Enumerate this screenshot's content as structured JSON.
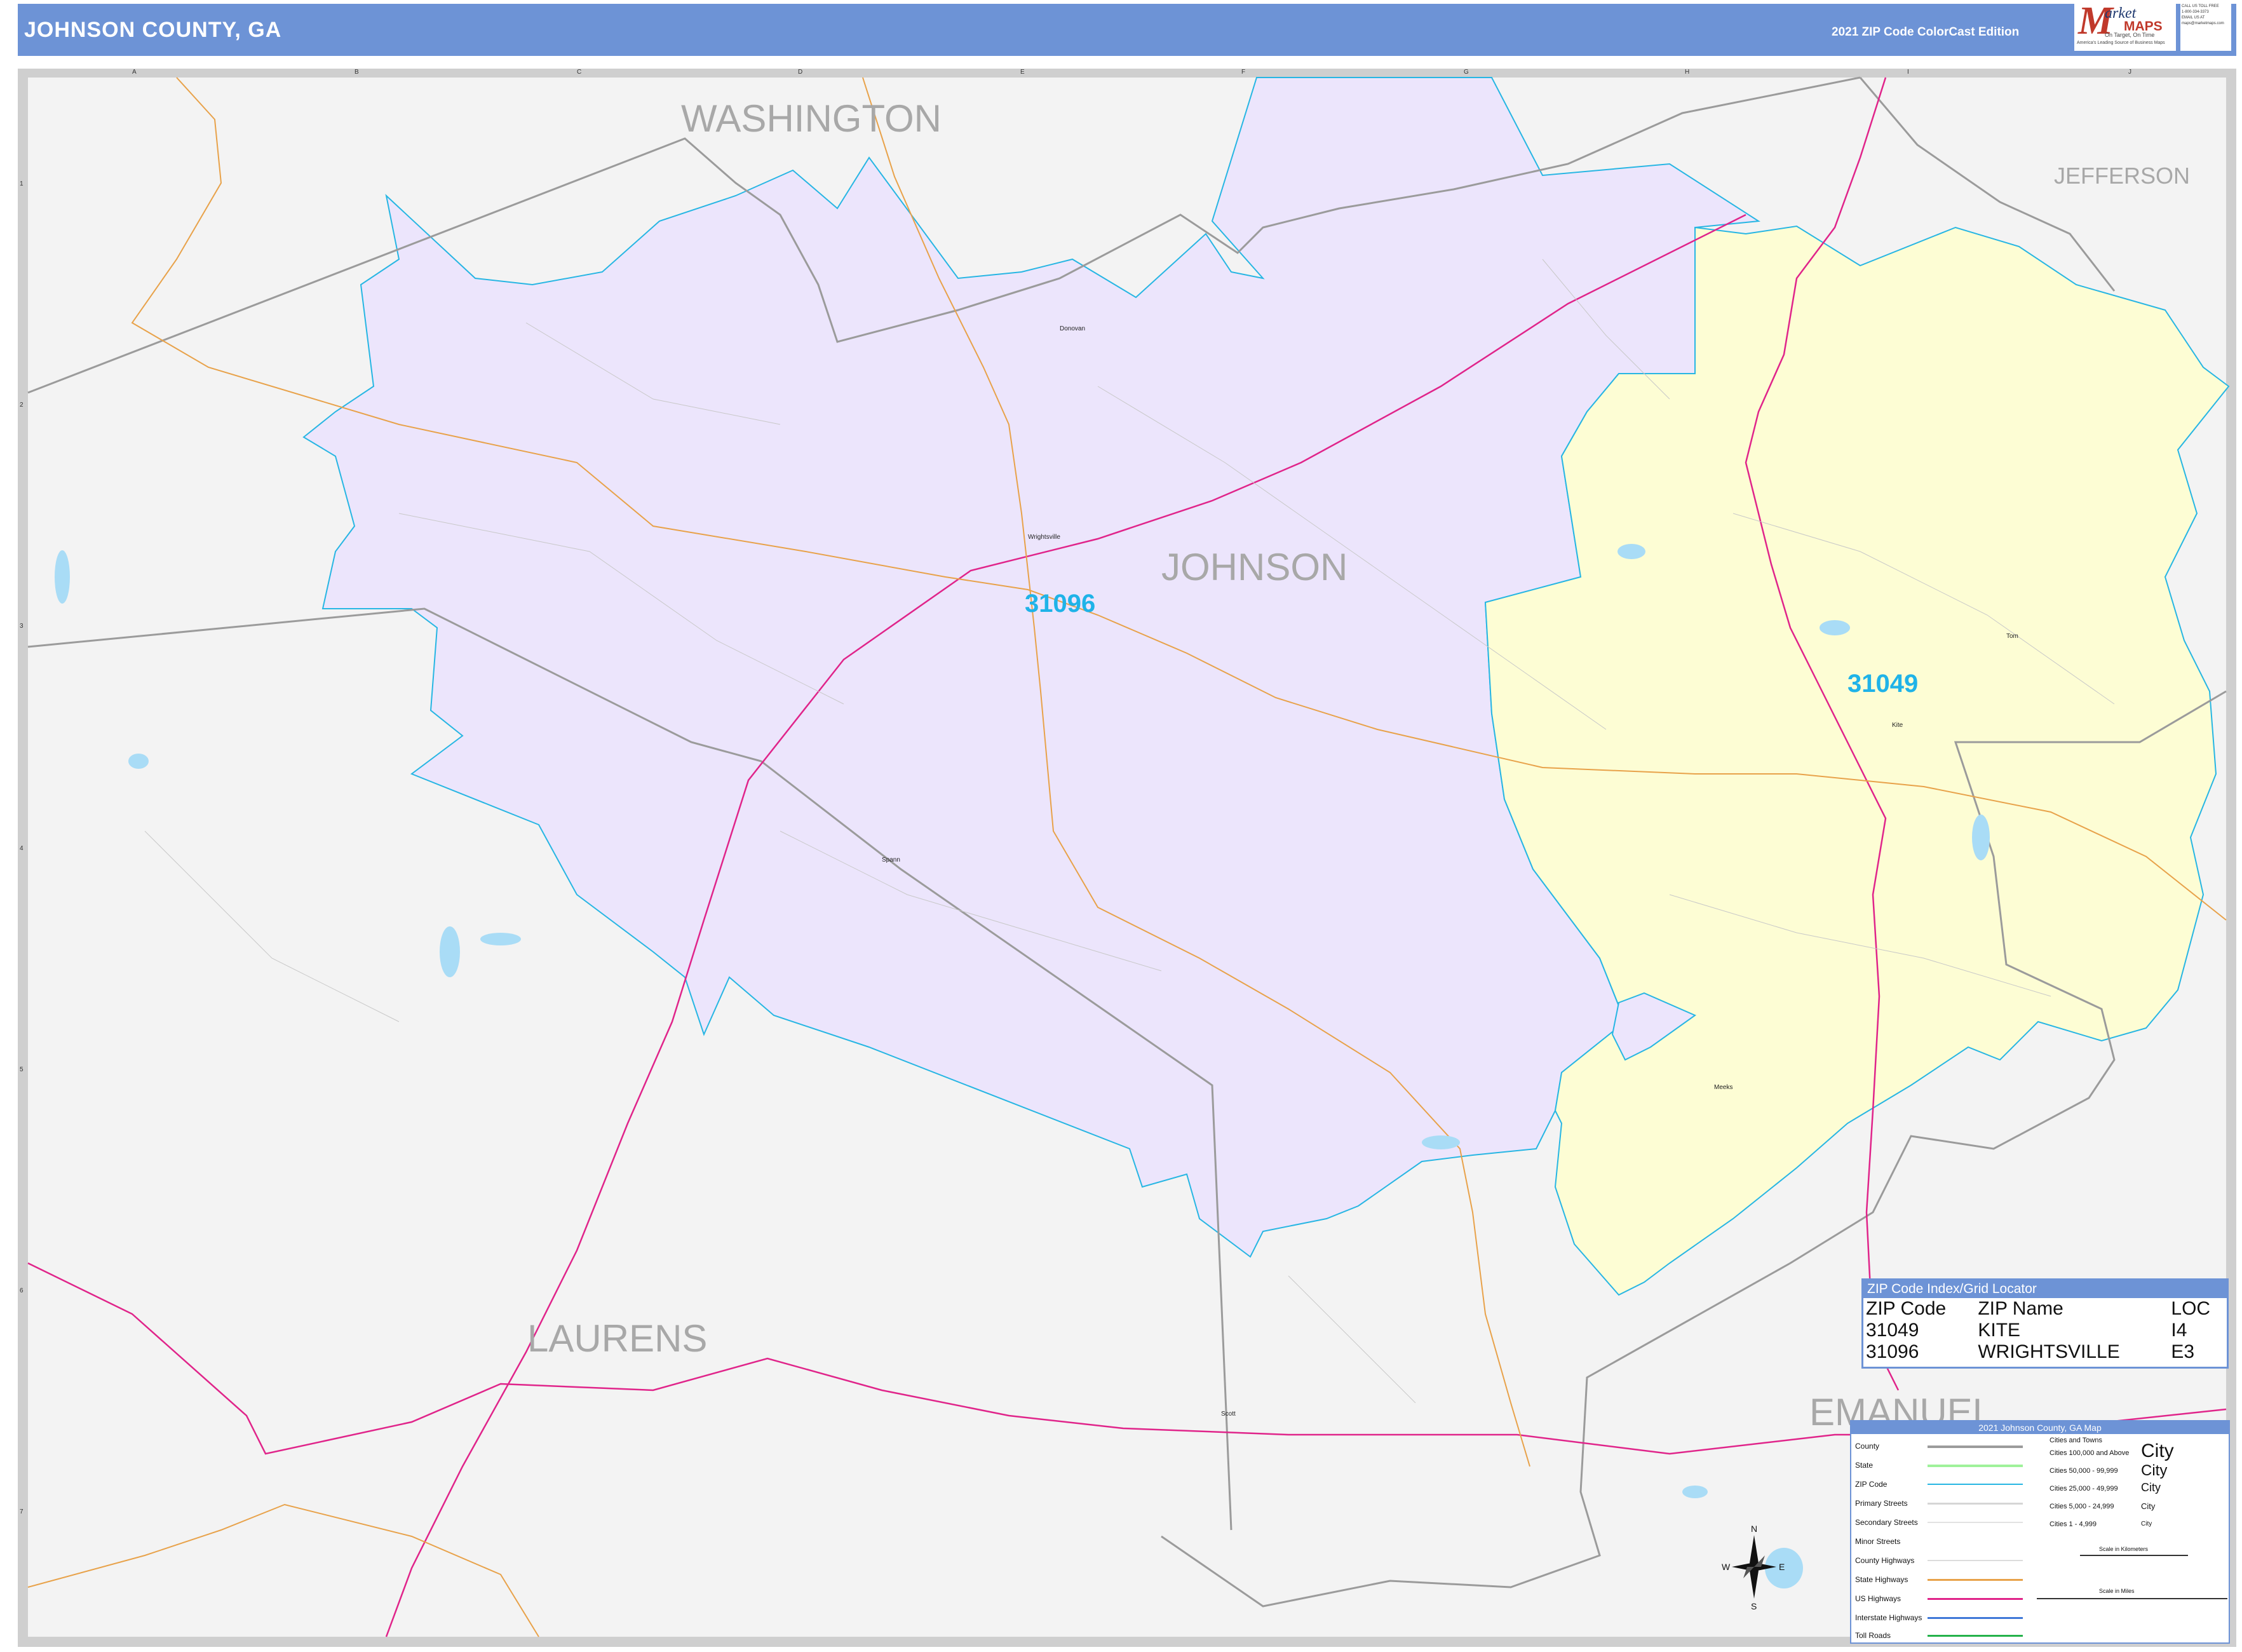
{
  "header": {
    "title": "JOHNSON COUNTY, GA",
    "edition": "2021 ZIP Code ColorCast Edition",
    "logo_m": "M",
    "logo_arket": "arket",
    "logo_maps": "MAPS",
    "logo_tagline": "On Target, On Time",
    "logo_subline": "America's Leading Source of Business Maps",
    "contact_lines": [
      "CALL US TOLL FREE",
      "1-800-334-3373",
      "EMAIL US AT",
      "maps@marketmaps.com"
    ]
  },
  "colors": {
    "header": "#6d93d6",
    "zip_31096": "#ece5fc",
    "zip_31049": "#fdfdd4",
    "outside": "#f3f3f3",
    "zip_border": "#27b6e3",
    "county_border": "#9b9b9b",
    "state_highway": "#e8a24a",
    "us_highway": "#e0248a",
    "water": "#a9dcf6"
  },
  "grid": {
    "columns": [
      "A",
      "B",
      "C",
      "D",
      "E",
      "F",
      "G",
      "H",
      "I",
      "J"
    ],
    "rows": [
      "1",
      "2",
      "3",
      "4",
      "5",
      "6",
      "7"
    ]
  },
  "counties": {
    "washington": "WASHINGTON",
    "johnson": "JOHNSON",
    "jefferson": "JEFFERSON",
    "laurens": "LAURENS",
    "emanuel": "EMANUEL"
  },
  "zips": [
    {
      "code": "31096",
      "name": "WRIGHTSVILLE",
      "loc": "E3"
    },
    {
      "code": "31049",
      "name": "KITE",
      "loc": "I4"
    }
  ],
  "places": {
    "donovan": "Donovan",
    "wrightsville": "Wrightsville",
    "kite": "Kite",
    "tom": "Tom",
    "meeks": "Meeks",
    "spann": "Spann",
    "scott": "Scott"
  },
  "index": {
    "title": "ZIP Code Index/Grid Locator",
    "headers": [
      "ZIP Code",
      "ZIP Name",
      "LOC"
    ],
    "rows": [
      [
        "31049",
        "KITE",
        "I4"
      ],
      [
        "31096",
        "WRIGHTSVILLE",
        "E3"
      ]
    ]
  },
  "legend": {
    "title": "2021 Johnson County, GA Map",
    "items": [
      "County",
      "State",
      "ZIP Code",
      "Primary Streets",
      "Secondary Streets",
      "Minor Streets",
      "County Highways",
      "State Highways",
      "US Highways",
      "Interstate Highways",
      "Toll Roads"
    ],
    "cities_header": "Cities and Towns",
    "city_sizes": [
      "Cities 100,000 and Above",
      "Cities 50,000 - 99,999",
      "Cities 25,000 - 49,999",
      "Cities 5,000 - 24,999",
      "Cities 1 - 4,999"
    ],
    "city_samples": [
      "City",
      "City",
      "City",
      "City",
      "City"
    ],
    "scale_km": "Scale in Kilometers",
    "scale_mi": "Scale in Miles",
    "compass": {
      "n": "N",
      "s": "S",
      "e": "E",
      "w": "W"
    }
  }
}
